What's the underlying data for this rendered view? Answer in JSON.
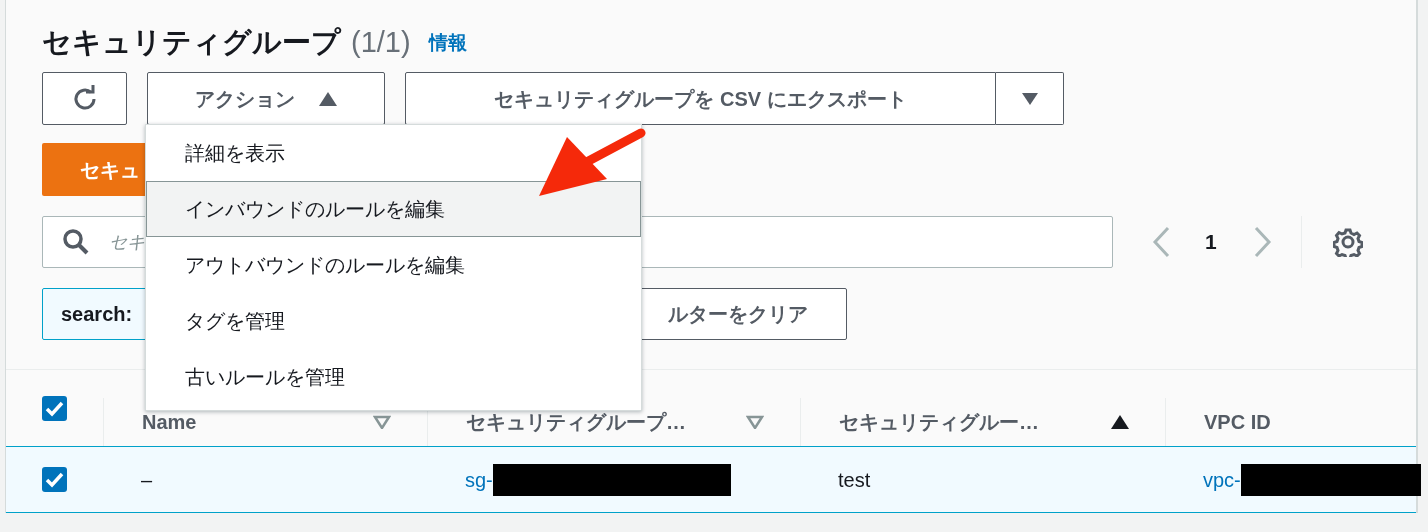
{
  "header": {
    "title": "セキュリティグループ",
    "count": "(1/1)",
    "info_link": "情報"
  },
  "toolbar": {
    "actions_button": {
      "label": "アクション",
      "expanded": true
    },
    "export_button": {
      "label": "セキュリティグループを CSV にエクスポート"
    }
  },
  "actions_menu": {
    "items": [
      {
        "label": "詳細を表示",
        "highlighted": false
      },
      {
        "label": "インバウンドのルールを編集",
        "highlighted": true
      },
      {
        "label": "アウトバウンドのルールを編集",
        "highlighted": false
      },
      {
        "label": "タグを管理",
        "highlighted": false
      },
      {
        "label": "古いルールを管理",
        "highlighted": false
      }
    ]
  },
  "create_button": {
    "label": "セキュ"
  },
  "search": {
    "placeholder": "セキ"
  },
  "pagination": {
    "page": "1"
  },
  "filter": {
    "token": "search:",
    "clear_button": "ルターをクリア"
  },
  "table": {
    "select_all_checked": true,
    "columns": [
      {
        "label": "Name",
        "sorted": false
      },
      {
        "label": "セキュリティグループ…",
        "sorted": false
      },
      {
        "label": "セキュリティグルー…",
        "sorted": true
      },
      {
        "label": "VPC ID"
      }
    ],
    "rows": [
      {
        "selected": true,
        "cells": [
          {
            "kind": "text",
            "text": "–"
          },
          {
            "kind": "link",
            "text": "sg-"
          },
          {
            "kind": "text",
            "text": "test"
          },
          {
            "kind": "link",
            "text": "vpc-"
          }
        ]
      }
    ]
  }
}
